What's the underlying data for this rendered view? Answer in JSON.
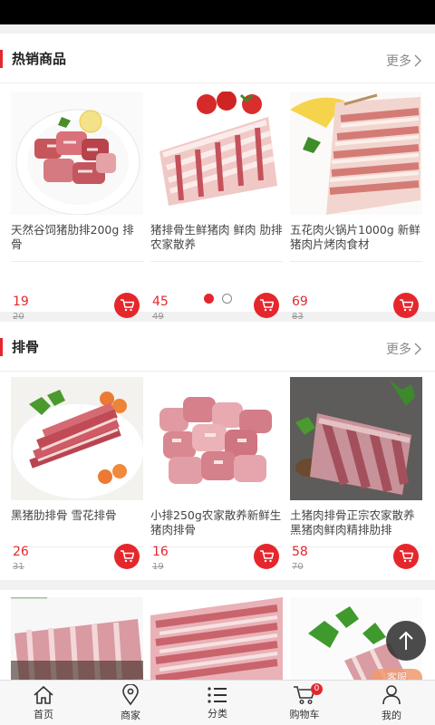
{
  "sections": [
    {
      "title": "热销商品",
      "more": "更多",
      "products": [
        {
          "name": "天然谷饲猪肋排200g 排骨",
          "price": "19",
          "old_price": "20"
        },
        {
          "name": "猪排骨生鲜猪肉 鲜肉 肋排 农家散养",
          "price": "45",
          "old_price": "49"
        },
        {
          "name": "五花肉火锅片1000g 新鲜猪肉片烤肉食材",
          "price": "69",
          "old_price": "83"
        }
      ]
    },
    {
      "title": "排骨",
      "more": "更多",
      "products": [
        {
          "name": "黑猪肋排骨 雪花排骨",
          "price": "26",
          "old_price": "31"
        },
        {
          "name": "小排250g农家散养新鲜生猪肉排骨",
          "price": "16",
          "old_price": "19"
        },
        {
          "name": "土猪肉排骨正宗农家散养黑猪肉鲜肉精排肋排",
          "price": "58",
          "old_price": "70"
        }
      ]
    }
  ],
  "carousel": {
    "pages": 2,
    "active": 0
  },
  "tabbar": {
    "items": [
      {
        "label": "首页",
        "icon": "home-icon"
      },
      {
        "label": "商家",
        "icon": "location-pin-icon"
      },
      {
        "label": "分类",
        "icon": "list-icon"
      },
      {
        "label": "购物车",
        "icon": "cart-icon",
        "badge": "0"
      },
      {
        "label": "我的",
        "icon": "user-icon"
      }
    ]
  },
  "floating": {
    "back_to_top_icon": "arrow-up-icon",
    "kefu_label": "客服"
  },
  "colors": {
    "accent": "#e5272d",
    "background": "#f1f1f1"
  }
}
